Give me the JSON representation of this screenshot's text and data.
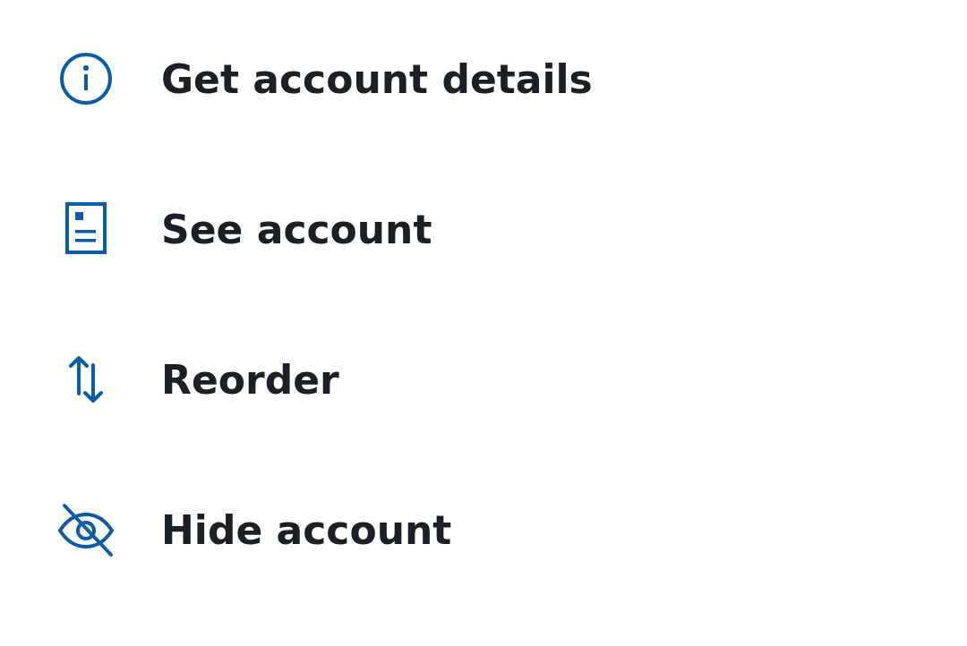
{
  "menu": {
    "items": [
      {
        "kind": "info",
        "label": "Get account details"
      },
      {
        "kind": "document",
        "label": "See account"
      },
      {
        "kind": "reorder",
        "label": "Reorder"
      },
      {
        "kind": "hide",
        "label": "Hide account"
      }
    ]
  }
}
